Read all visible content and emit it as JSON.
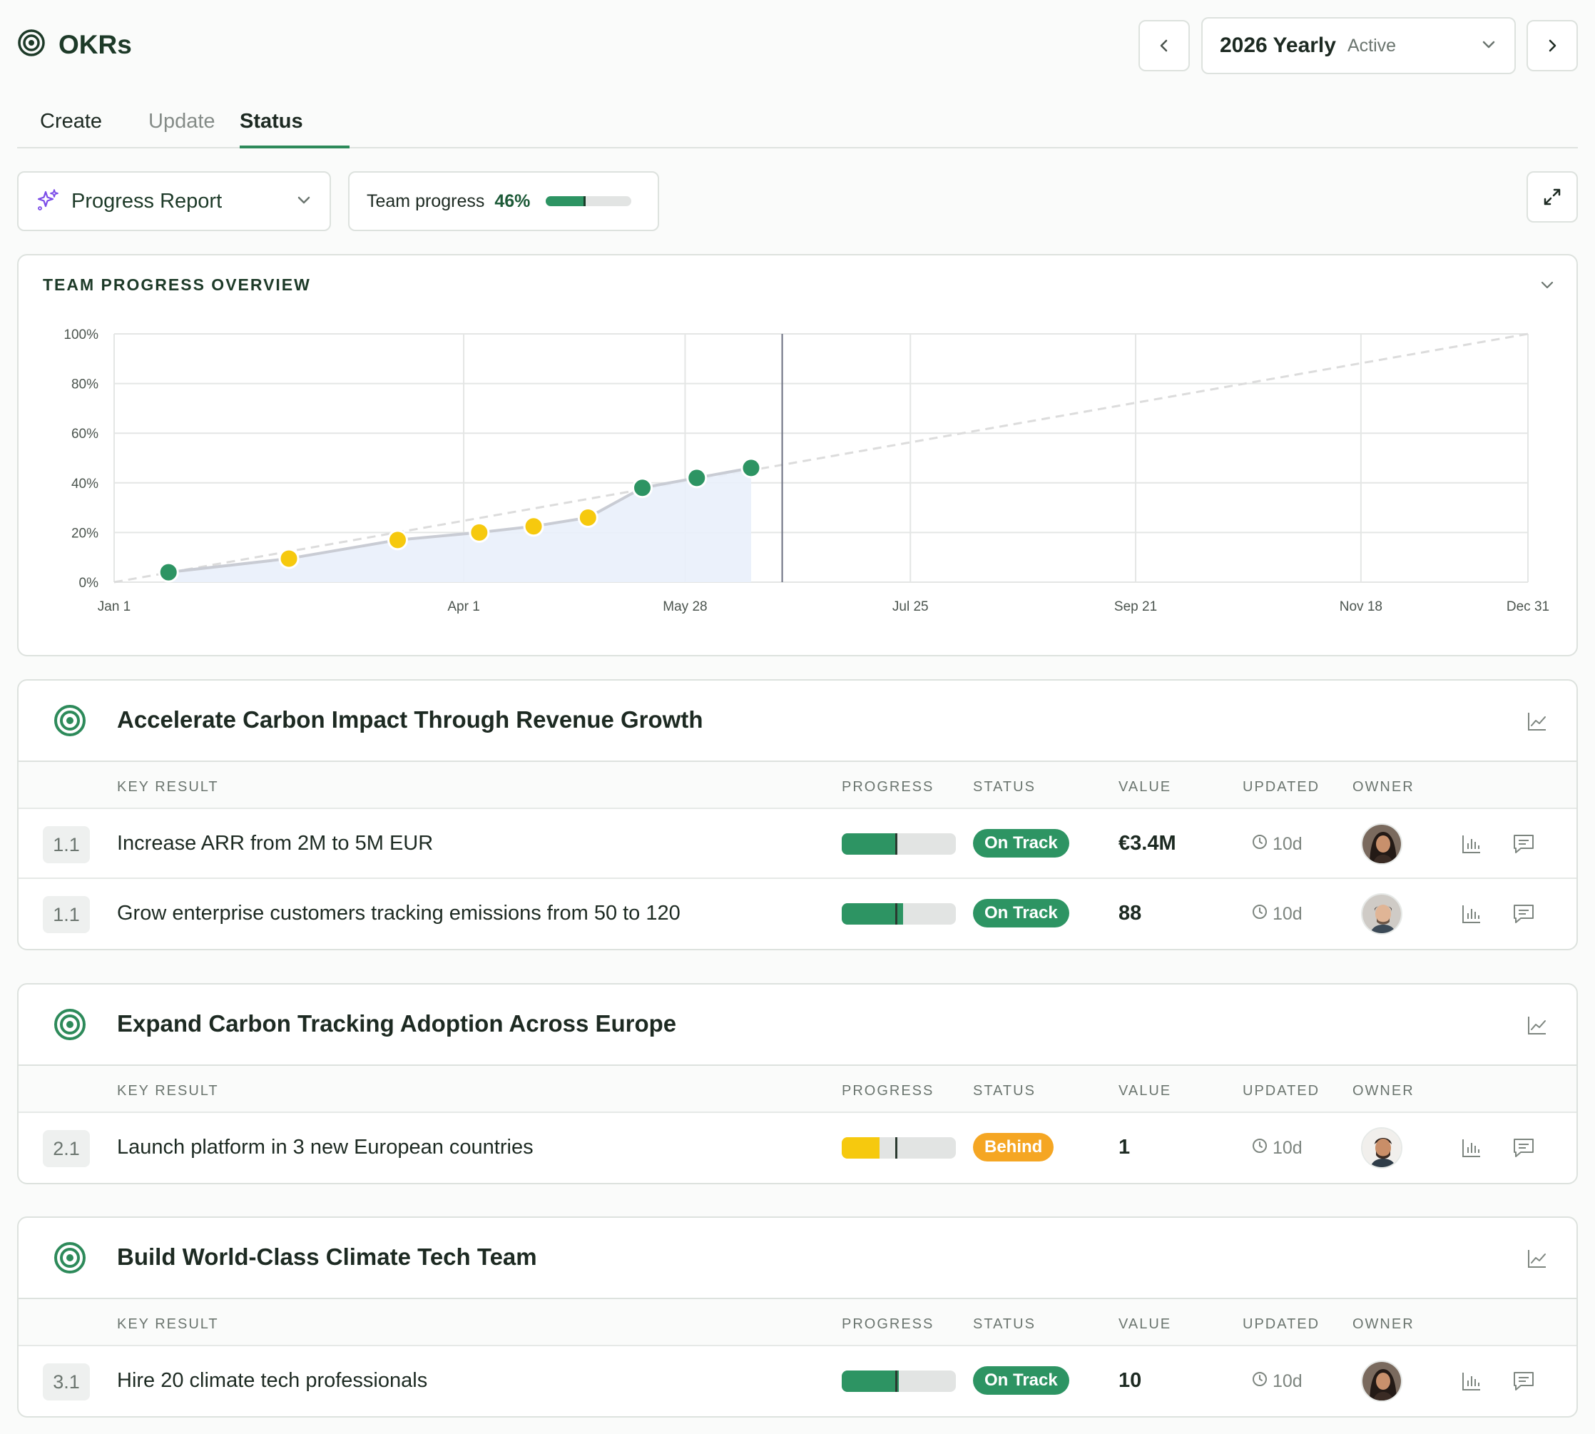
{
  "header": {
    "title": "OKRs",
    "period_name": "2026 Yearly",
    "period_state": "Active"
  },
  "tabs": [
    {
      "label": "Create"
    },
    {
      "label": "Update"
    },
    {
      "label": "Status",
      "active": true
    }
  ],
  "toolbar": {
    "report_label": "Progress Report",
    "team_progress_label": "Team progress",
    "team_progress_value": "46%",
    "team_progress_fraction": 0.46
  },
  "chart_card": {
    "title": "TEAM PROGRESS OVERVIEW"
  },
  "chart_data": {
    "type": "line",
    "x_ticks": [
      "Jan 1",
      "Apr 1",
      "May 28",
      "Jul 25",
      "Sep 21",
      "Nov 18",
      "Dec 31"
    ],
    "x_tick_days": [
      0,
      90,
      147,
      205,
      263,
      321,
      364
    ],
    "y_ticks": [
      "100%",
      "80%",
      "60%",
      "40%",
      "20%",
      "0%"
    ],
    "ylim": [
      0,
      100
    ],
    "xlim_days": [
      0,
      364
    ],
    "today_day": 172,
    "target_line": {
      "from": [
        0,
        0
      ],
      "to": [
        364,
        100
      ],
      "style": "dashed"
    },
    "series": [
      {
        "points": [
          {
            "day": 14,
            "value": 4,
            "status": "on-track"
          },
          {
            "day": 45,
            "value": 9.5,
            "status": "behind"
          },
          {
            "day": 73,
            "value": 17,
            "status": "behind"
          },
          {
            "day": 94,
            "value": 20,
            "status": "behind"
          },
          {
            "day": 108,
            "value": 22.5,
            "status": "behind"
          },
          {
            "day": 122,
            "value": 26,
            "status": "behind"
          },
          {
            "day": 136,
            "value": 38,
            "status": "on-track"
          },
          {
            "day": 150,
            "value": 42,
            "status": "on-track"
          },
          {
            "day": 164,
            "value": 46,
            "status": "on-track"
          }
        ]
      }
    ],
    "grid": true,
    "colors": {
      "on_track": "#2d9463",
      "behind": "#f6c90e",
      "area": "#e9effb",
      "line": "#c9ccd4",
      "target": "#dcdcdc",
      "today": "#6b6f80"
    }
  },
  "columns": {
    "key_result": "KEY RESULT",
    "progress": "PROGRESS",
    "status": "STATUS",
    "value": "VALUE",
    "updated": "UPDATED",
    "owner": "OWNER"
  },
  "objectives": [
    {
      "title": "Accelerate Carbon Impact Through Revenue Growth",
      "key_results": [
        {
          "id": "1.1",
          "name": "Increase ARR from 2M to 5M EUR",
          "progress": 0.47,
          "expected": 0.47,
          "status": "On Track",
          "status_color": "#2d9463",
          "value": "€3.4M",
          "updated": "10d",
          "owner": "female"
        },
        {
          "id": "1.1",
          "name": "Grow enterprise customers tracking emissions from 50 to 120",
          "progress": 0.54,
          "expected": 0.47,
          "status": "On Track",
          "status_color": "#2d9463",
          "value": "88",
          "updated": "10d",
          "owner": "male"
        }
      ]
    },
    {
      "title": "Expand Carbon Tracking Adoption Across Europe",
      "key_results": [
        {
          "id": "2.1",
          "name": "Launch platform in 3 new European countries",
          "progress": 0.33,
          "expected": 0.47,
          "status": "Behind",
          "status_color": "#f5a623",
          "value": "1",
          "updated": "10d",
          "owner": "male2"
        }
      ]
    },
    {
      "title": "Build World-Class Climate Tech Team",
      "key_results": [
        {
          "id": "3.1",
          "name": "Hire 20 climate tech professionals",
          "progress": 0.5,
          "expected": 0.47,
          "status": "On Track",
          "status_color": "#2d9463",
          "value": "10",
          "updated": "10d",
          "owner": "female"
        }
      ]
    }
  ]
}
